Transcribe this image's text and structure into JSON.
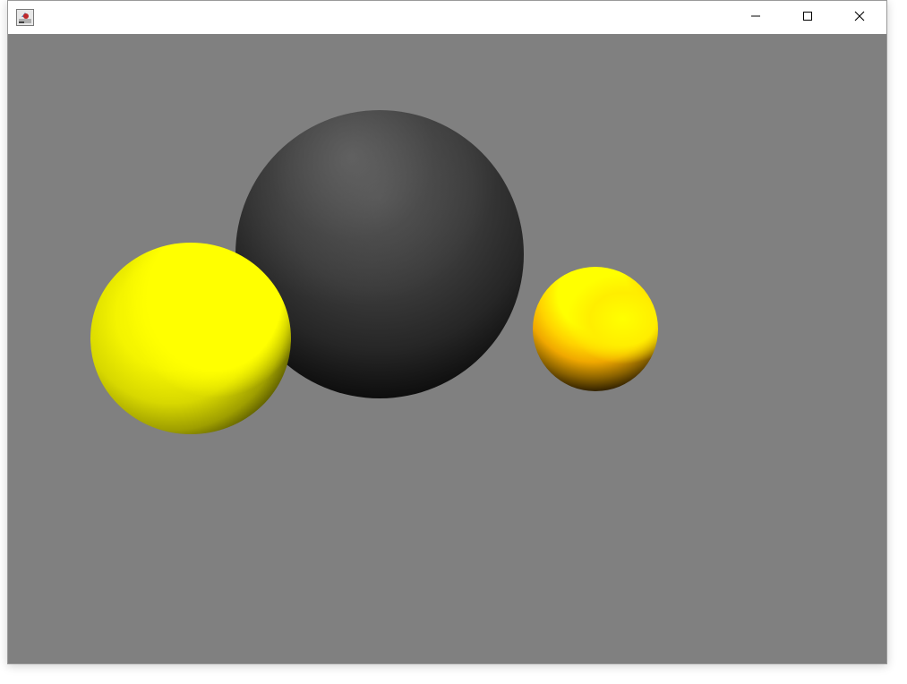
{
  "window": {
    "title": "",
    "icon": "java-app-icon",
    "controls": {
      "minimize": "minimize-icon",
      "maximize": "maximize-icon",
      "close": "close-icon"
    }
  },
  "scene": {
    "background_color": "#808080",
    "spheres": [
      {
        "name": "dark-gray-sphere",
        "color": "#3a3a3a"
      },
      {
        "name": "left-yellow-sphere",
        "color": "#ffff00"
      },
      {
        "name": "right-yellow-sphere",
        "color": "#ffd200"
      }
    ]
  }
}
